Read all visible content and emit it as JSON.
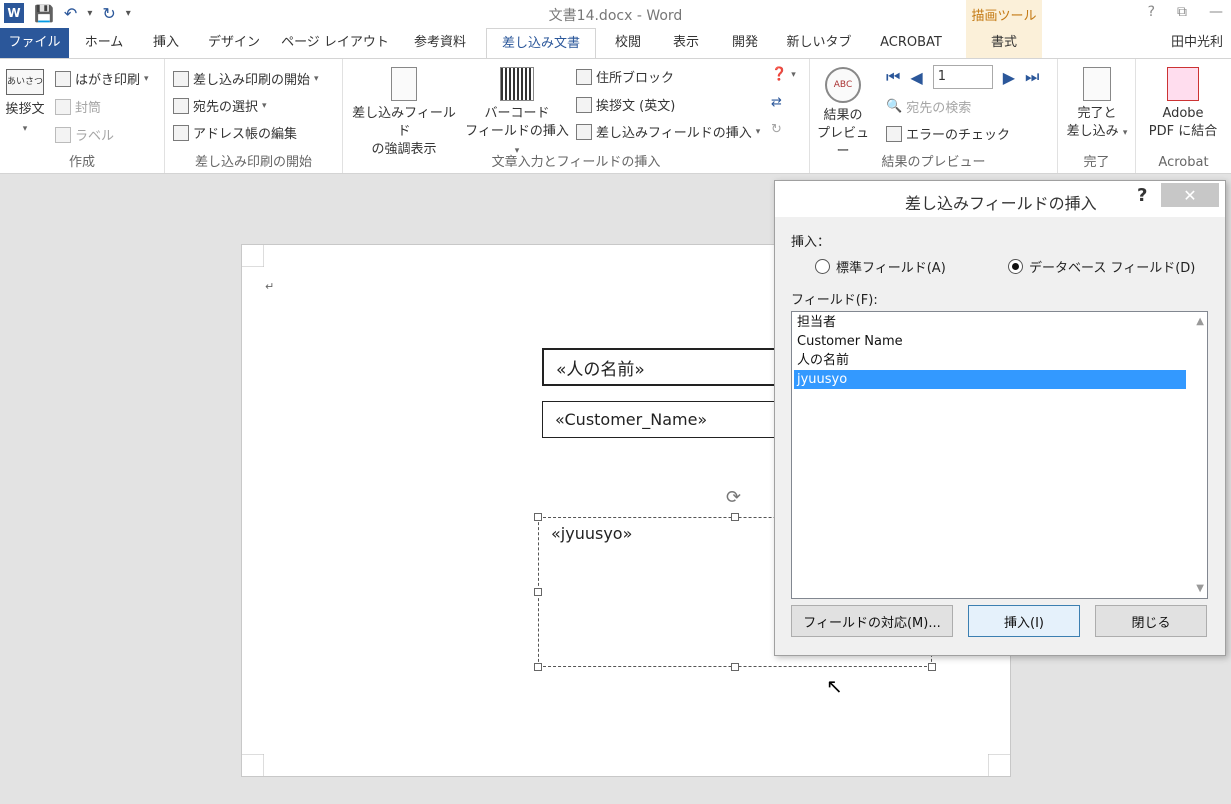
{
  "titlebar": {
    "doc_title": "文書14.docx - Word",
    "drawing_tools": "描画ツール",
    "help": "?",
    "restore": "⧉",
    "minimize": "—"
  },
  "tabs": [
    {
      "label": "ファイル"
    },
    {
      "label": "ホーム"
    },
    {
      "label": "挿入"
    },
    {
      "label": "デザイン"
    },
    {
      "label": "ページ レイアウト"
    },
    {
      "label": "参考資料"
    },
    {
      "label": "差し込み文書"
    },
    {
      "label": "校閲"
    },
    {
      "label": "表示"
    },
    {
      "label": "開発"
    },
    {
      "label": "新しいタブ"
    },
    {
      "label": "ACROBAT"
    },
    {
      "label": "書式"
    }
  ],
  "user": "田中光利",
  "ribbon": {
    "create": {
      "label": "作成",
      "greeting_btn": "挨拶文",
      "greeting_icon": "あいさつ",
      "postcard": "はがき印刷",
      "envelope": "封筒",
      "label_btn": "ラベル"
    },
    "start": {
      "label": "差し込み印刷の開始",
      "start_merge": "差し込み印刷の開始",
      "select_recipients": "宛先の選択",
      "edit_address": "アドレス帳の編集"
    },
    "write": {
      "label": "文章入力とフィールドの挿入",
      "highlight_l1": "差し込みフィールド",
      "highlight_l2": "の強調表示",
      "barcode_l1": "バーコード",
      "barcode_l2": "フィールドの挿入",
      "address_block": "住所ブロック",
      "greeting_en": "挨拶文 (英文)",
      "insert_field": "差し込みフィールドの挿入"
    },
    "preview": {
      "label": "結果のプレビュー",
      "preview_l1": "結果の",
      "preview_l2": "プレビュー",
      "record": "1",
      "find_recipient": "宛先の検索",
      "check_errors": "エラーのチェック"
    },
    "finish": {
      "label": "完了",
      "finish_l1": "完了と",
      "finish_l2": "差し込み"
    },
    "acrobat": {
      "label": "Acrobat",
      "merge_l1": "Adobe",
      "merge_l2": "PDF に結合"
    }
  },
  "document": {
    "field1": "«人の名前»",
    "field2": "«Customer_Name»",
    "field3": "«jyuusyo»",
    "para_mark": "↵"
  },
  "dialog": {
    "title": "差し込みフィールドの挿入",
    "help": "?",
    "close": "✕",
    "insert_label": "挿入：",
    "radio_standard": "標準フィールド(A)",
    "radio_database": "データベース フィールド(D)",
    "fields_label": "フィールド(F):",
    "fields": [
      "担当者",
      "Customer Name",
      "人の名前",
      "jyuusyo"
    ],
    "btn_match": "フィールドの対応(M)...",
    "btn_insert": "挿入(I)",
    "btn_close": "閉じる"
  }
}
